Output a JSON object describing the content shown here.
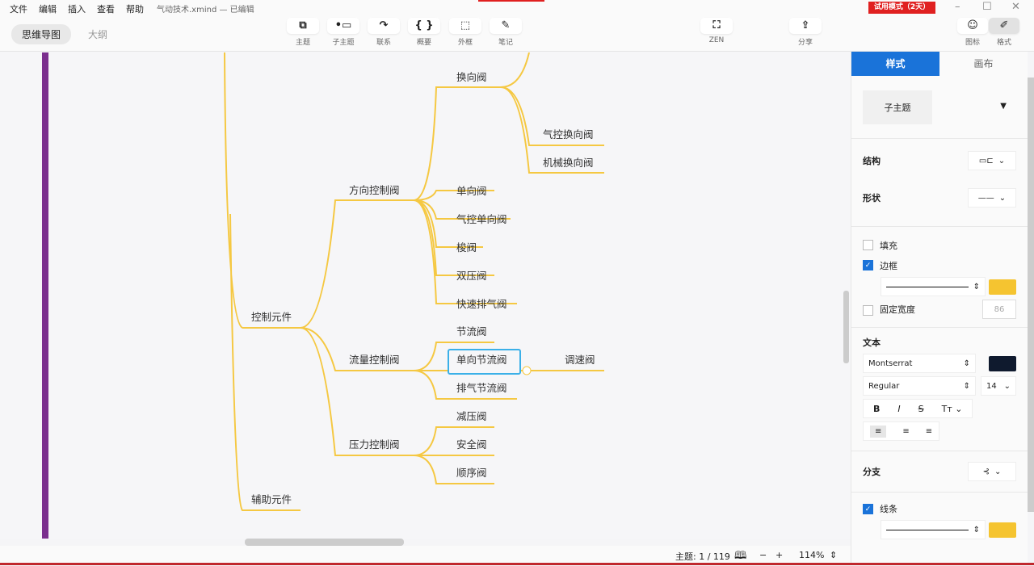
{
  "menu": {
    "items": [
      "文件",
      "编辑",
      "插入",
      "查看",
      "帮助"
    ],
    "title": "气动技术.xmind — 已编辑"
  },
  "view_tabs": [
    "思维导图",
    "大纲"
  ],
  "toolbar": [
    {
      "icon": "topic-icon",
      "glyph": "⧉",
      "label": "主题"
    },
    {
      "icon": "subtopic-icon",
      "glyph": "•▭",
      "label": "子主题"
    },
    {
      "icon": "relationship-icon",
      "glyph": "↷",
      "label": "联系"
    },
    {
      "icon": "summary-icon",
      "glyph": "{ }",
      "label": "概要"
    },
    {
      "icon": "boundary-icon",
      "glyph": "⬚",
      "label": "外框"
    },
    {
      "icon": "note-icon",
      "glyph": "✎",
      "label": "笔记"
    }
  ],
  "zen": {
    "glyph": "⛶",
    "label": "ZEN"
  },
  "share": {
    "glyph": "⇪",
    "label": "分享"
  },
  "trial": "试用模式（2天）",
  "right_toolbar": [
    {
      "glyph": "☺",
      "label": "图标"
    },
    {
      "glyph": "✐",
      "label": "格式"
    }
  ],
  "map": {
    "l1": [
      "控制元件",
      "辅助元件"
    ],
    "l2": [
      "方向控制阀",
      "流量控制阀",
      "压力控制阀"
    ],
    "dir": [
      "换向阀",
      "单向阀",
      "气控单向阀",
      "梭阀",
      "双压阀",
      "快速排气阀"
    ],
    "switch": [
      "气控换向阀",
      "机械换向阀"
    ],
    "flow": [
      "节流阀",
      "单向节流阀",
      "排气节流阀"
    ],
    "flow_child": "调速阀",
    "pressure": [
      "减压阀",
      "安全阀",
      "顺序阀"
    ],
    "branch_color": "#f5c842",
    "selected_color": "#3bb0e8"
  },
  "status": {
    "topics": "主题: 1 / 119",
    "zoom": "114%"
  },
  "panel": {
    "tabs": [
      "样式",
      "画布"
    ],
    "topic_type": "子主题",
    "structure": "结构",
    "shape": "形状",
    "fill": {
      "label": "填充",
      "checked": false
    },
    "border": {
      "label": "边框",
      "checked": true,
      "color": "#f5c430"
    },
    "fixed_width": {
      "label": "固定宽度",
      "checked": false,
      "value": "86"
    },
    "text": {
      "label": "文本",
      "font": "Montserrat",
      "color": "#0f1a2e",
      "weight": "Regular",
      "size": "14"
    },
    "branch": "分支",
    "line": {
      "label": "线条",
      "checked": true,
      "color": "#f5c430"
    }
  }
}
